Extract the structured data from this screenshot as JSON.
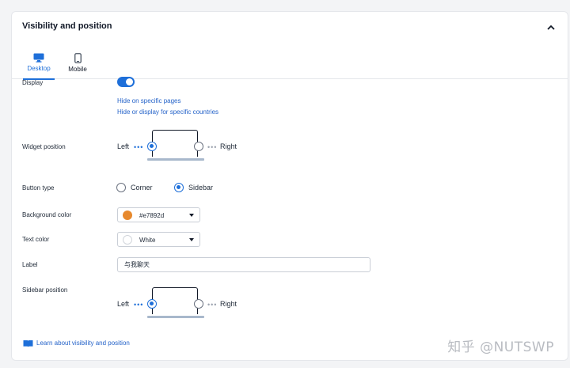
{
  "section": {
    "title": "Visibility and position"
  },
  "tabs": [
    {
      "label": "Desktop",
      "icon": "desktop-icon",
      "active": true
    },
    {
      "label": "Mobile",
      "icon": "mobile-icon",
      "active": false
    }
  ],
  "display": {
    "label": "Display",
    "enabled": true,
    "links": [
      "Hide on specific pages",
      "Hide or display for specific countries"
    ]
  },
  "widget_position": {
    "label": "Widget position",
    "left_label": "Left",
    "right_label": "Right",
    "selected": "Left"
  },
  "button_type": {
    "label": "Button type",
    "options": [
      "Corner",
      "Sidebar"
    ],
    "selected": "Sidebar"
  },
  "background_color": {
    "label": "Background color",
    "value": "#e7892d",
    "swatch": "#e7892d"
  },
  "text_color": {
    "label": "Text color",
    "value": "White",
    "swatch": "#ffffff"
  },
  "label_field": {
    "label": "Label",
    "value": "与我聊天"
  },
  "sidebar_position": {
    "label": "Sidebar position",
    "left_label": "Left",
    "right_label": "Right",
    "selected": "Left"
  },
  "learn_link": "Learn about visibility and position",
  "watermark": "知乎 @NUTSWP",
  "colors": {
    "accent": "#1e6fd9",
    "link": "#2563c9"
  }
}
